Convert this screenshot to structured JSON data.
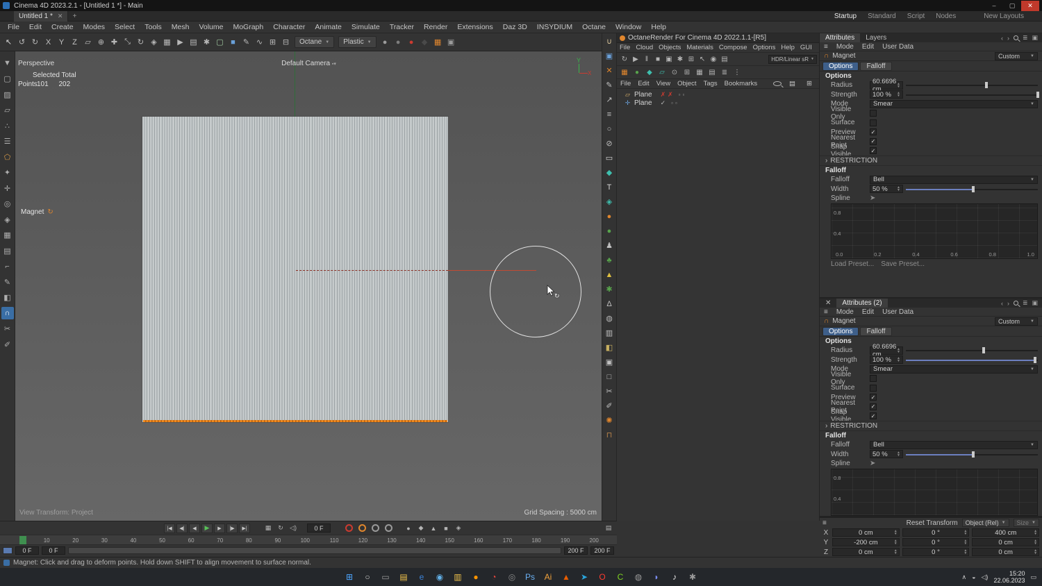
{
  "titlebar": {
    "title": "Cinema 4D 2023.2.1 - [Untitled 1 *] - Main"
  },
  "tabbar": {
    "tab_label": "Untitled 1 *",
    "layouts": [
      {
        "name": "layout-startup",
        "label": "Startup",
        "cls": "active"
      },
      {
        "name": "layout-standard",
        "label": "Standard"
      },
      {
        "name": "layout-script",
        "label": "Script"
      },
      {
        "name": "layout-nodes",
        "label": "Nodes"
      }
    ],
    "new_layout_label": "New Layouts"
  },
  "menubar": [
    "File",
    "Edit",
    "Create",
    "Modes",
    "Select",
    "Tools",
    "Mesh",
    "Volume",
    "MoGraph",
    "Character",
    "Animate",
    "Simulate",
    "Tracker",
    "Render",
    "Extensions",
    "Daz 3D",
    "INSYDIUM",
    "Octane",
    "Window",
    "Help"
  ],
  "toolbar": {
    "icons_a": [
      {
        "name": "live-selection-icon",
        "glyph": "↖",
        "color": "#d8d8d8"
      },
      {
        "name": "undo-icon",
        "glyph": "↺",
        "color": "#b8b8b8"
      },
      {
        "name": "redo-icon",
        "glyph": "↻",
        "color": "#b8b8b8"
      },
      {
        "name": "lock-x-axis-icon",
        "glyph": "X",
        "color": "#c4c4c4"
      },
      {
        "name": "lock-y-axis-icon",
        "glyph": "Y",
        "color": "#c4c4c4"
      },
      {
        "name": "lock-z-axis-icon",
        "glyph": "Z",
        "color": "#c4c4c4"
      },
      {
        "name": "workplane-icon",
        "glyph": "▱",
        "color": "#b8b8b8"
      },
      {
        "name": "coordinate-system-icon",
        "glyph": "⊕",
        "color": "#b8b8b8"
      },
      {
        "name": "move-tool-icon",
        "glyph": "✚",
        "color": "#b8b8b8"
      },
      {
        "name": "scale-tool-icon",
        "glyph": "⤡",
        "color": "#b8b8b8"
      },
      {
        "name": "rotate-tool-icon",
        "glyph": "↻",
        "color": "#b8b8b8"
      },
      {
        "name": "snap-icon",
        "glyph": "◈",
        "color": "#b8b8b8"
      },
      {
        "name": "quantize-icon",
        "glyph": "▦",
        "color": "#b8b8b8"
      },
      {
        "name": "render-view-icon",
        "glyph": "▶",
        "color": "#b8b8b8"
      },
      {
        "name": "render-picture-viewer-icon",
        "glyph": "▤",
        "color": "#b8b8b8"
      },
      {
        "name": "render-settings-icon",
        "glyph": "✱",
        "color": "#b8b8b8"
      },
      {
        "name": "model-mode-icon",
        "glyph": "▢",
        "color": "#9fc79f"
      },
      {
        "name": "cube-primitive-icon",
        "glyph": "■",
        "color": "#6aa0d8"
      },
      {
        "name": "pen-tool-icon",
        "glyph": "✎",
        "color": "#b8b8b8"
      },
      {
        "name": "spline-tool-icon",
        "glyph": "∿",
        "color": "#b8b8b8"
      },
      {
        "name": "array-icon",
        "glyph": "⊞",
        "color": "#b8b8b8"
      },
      {
        "name": "instance-icon",
        "glyph": "⊟",
        "color": "#b8b8b8"
      }
    ],
    "octane_btn": "Octane",
    "plastic_btn": "Plastic",
    "icons_b": [
      {
        "name": "material-sphere-icon",
        "glyph": "●",
        "color": "#9c9c9c"
      },
      {
        "name": "material-sphere-2-icon",
        "glyph": "●",
        "color": "#7d7d7d"
      },
      {
        "name": "xparticles-icon",
        "glyph": "●",
        "color": "#cc3b30"
      },
      {
        "name": "insydium-icon",
        "glyph": "◆",
        "color": "#4a4a4a"
      },
      {
        "name": "turbulencefd-icon",
        "glyph": "▦",
        "color": "#e0862d"
      },
      {
        "name": "cubes-array-icon",
        "glyph": "▣",
        "color": "#9a9a9a"
      }
    ]
  },
  "left_palette": [
    {
      "name": "convert-icon",
      "glyph": "▼",
      "color": "#aeaeae"
    },
    {
      "name": "model-mode-icon",
      "glyph": "▢",
      "color": "#aeaeae"
    },
    {
      "name": "texture-mode-icon",
      "glyph": "▨",
      "color": "#aeaeae"
    },
    {
      "name": "workplane-mode-icon",
      "glyph": "▱",
      "color": "#aeaeae"
    },
    {
      "name": "points-mode-icon",
      "glyph": "∴",
      "color": "#aeaeae"
    },
    {
      "name": "edges-mode-icon",
      "glyph": "☰",
      "color": "#aeaeae"
    },
    {
      "name": "polygons-mode-icon",
      "glyph": "⬠",
      "color": "#d89b4a"
    },
    {
      "name": "tweak-mode-icon",
      "glyph": "✦",
      "color": "#aeaeae"
    },
    {
      "name": "enable-axis-icon",
      "glyph": "✛",
      "color": "#aeaeae"
    },
    {
      "name": "viewport-solo-icon",
      "glyph": "◎",
      "color": "#aeaeae"
    },
    {
      "name": "snap-toggle-icon",
      "glyph": "◈",
      "color": "#aeaeae"
    },
    {
      "name": "quantize-toggle-icon",
      "glyph": "▦",
      "color": "#aeaeae"
    },
    {
      "name": "workplane-snap-icon",
      "glyph": "▤",
      "color": "#aeaeae"
    },
    {
      "name": "measure-icon",
      "glyph": "⌐",
      "color": "#aeaeae"
    },
    {
      "name": "brush-icon",
      "glyph": "✎",
      "color": "#aeaeae"
    },
    {
      "name": "mirror-icon",
      "glyph": "◧",
      "color": "#aeaeae"
    },
    {
      "name": "magnet-tool-icon",
      "glyph": "∩",
      "color": "#ffffff",
      "cls": "active"
    },
    {
      "name": "knife-icon",
      "glyph": "✂",
      "color": "#aeaeae"
    },
    {
      "name": "paint-icon",
      "glyph": "✐",
      "color": "#aeaeae"
    }
  ],
  "viewport": {
    "view_label": "Perspective",
    "hud_line1": "Selected Total",
    "hud_points_label": "Points",
    "hud_points_selected": "101",
    "hud_points_total": "202",
    "camera_label": "Default Camera",
    "tool_hint": "Magnet",
    "axis_y": "Y",
    "axis_x": "X",
    "transform_label": "View Transform: Project",
    "grid_label": "Grid Spacing : 5000 cm"
  },
  "right_strip": [
    {
      "name": "coffee-cup-icon",
      "glyph": "∪",
      "color": "#d8c49a"
    },
    {
      "name": "uv-edit-icon",
      "glyph": "▣",
      "color": "#6a9fd8"
    },
    {
      "name": "xpresso-icon",
      "glyph": "✕",
      "color": "#e0862d"
    },
    {
      "name": "pen-icon",
      "glyph": "✎",
      "color": "#c0c0c0"
    },
    {
      "name": "export-icon",
      "glyph": "↗",
      "color": "#c0c0c0"
    },
    {
      "name": "list-icon",
      "glyph": "≡",
      "color": "#c0c0c0"
    },
    {
      "name": "circle-icon",
      "glyph": "○",
      "color": "#c0c0c0"
    },
    {
      "name": "prohibit-icon",
      "glyph": "⊘",
      "color": "#c0c0c0"
    },
    {
      "name": "plane-primitive-icon",
      "glyph": "▭",
      "color": "#d8d8d8"
    },
    {
      "name": "diamond-icon",
      "glyph": "◆",
      "color": "#3fbfae"
    },
    {
      "name": "text-tool-icon",
      "glyph": "T",
      "color": "#d8d8d8"
    },
    {
      "name": "diamond-small-icon",
      "glyph": "◈",
      "color": "#3fbfae"
    },
    {
      "name": "octane-sphere-icon",
      "glyph": "●",
      "color": "#e0862d"
    },
    {
      "name": "green-sphere-icon",
      "glyph": "●",
      "color": "#58a44c"
    },
    {
      "name": "figure-icon",
      "glyph": "♟",
      "color": "#c0c0c0"
    },
    {
      "name": "tree-icon",
      "glyph": "♣",
      "color": "#58a44c"
    },
    {
      "name": "warning-icon",
      "glyph": "▲",
      "color": "#e0c040"
    },
    {
      "name": "gear-green-icon",
      "glyph": "✱",
      "color": "#58a44c"
    },
    {
      "name": "flask-icon",
      "glyph": "Δ",
      "color": "#c0c0c0"
    },
    {
      "name": "sphere-gray-icon",
      "glyph": "◍",
      "color": "#b8b8b8"
    },
    {
      "name": "chart-icon",
      "glyph": "▥",
      "color": "#c0c0c0"
    },
    {
      "name": "palette-icon",
      "glyph": "◧",
      "color": "#c8b060"
    },
    {
      "name": "camera-icon",
      "glyph": "▣",
      "color": "#c0c0c0"
    },
    {
      "name": "screen-icon",
      "glyph": "□",
      "color": "#c0c0c0"
    },
    {
      "name": "scissors-icon",
      "glyph": "✂",
      "color": "#c0c0c0"
    },
    {
      "name": "pen2-icon",
      "glyph": "✐",
      "color": "#c0c0c0"
    },
    {
      "name": "flower-icon",
      "glyph": "✺",
      "color": "#e0862d"
    },
    {
      "name": "chair-icon",
      "glyph": "⊓",
      "color": "#b8834a"
    }
  ],
  "octane_win": {
    "title": "OctaneRender For Cinema 4D 2022.1.1-[R5]",
    "menus": [
      "File",
      "Cloud",
      "Objects",
      "Materials",
      "Compose",
      "Options",
      "Help",
      "GUI"
    ],
    "lut_label": "HDR/Linear sR",
    "tb1_icons": [
      {
        "name": "refresh-icon",
        "glyph": "↻",
        "color": "#b4b4b4"
      },
      {
        "name": "render-start-icon",
        "glyph": "▶",
        "color": "#b4b4b4"
      },
      {
        "name": "pause-icon",
        "glyph": "‖",
        "color": "#b4b4b4"
      },
      {
        "name": "stop-icon",
        "glyph": "■",
        "color": "#b4b4b4"
      },
      {
        "name": "lock-resolution-icon",
        "glyph": "▣",
        "color": "#b4b4b4"
      },
      {
        "name": "settings-gear-icon",
        "glyph": "✱",
        "color": "#b4b4b4"
      },
      {
        "name": "region-render-icon",
        "glyph": "⊞",
        "color": "#b4b4b4"
      },
      {
        "name": "pick-material-icon",
        "glyph": "↖",
        "color": "#b4b4b4"
      },
      {
        "name": "camera-view-icon",
        "glyph": "◉",
        "color": "#b4b4b4"
      },
      {
        "name": "film-settings-icon",
        "glyph": "▤",
        "color": "#b4b4b4"
      }
    ],
    "tb2_icons": [
      {
        "name": "octane-cube-icon",
        "glyph": "▦",
        "color": "#e0862d"
      },
      {
        "name": "livedb-icon",
        "glyph": "●",
        "color": "#58a44c"
      },
      {
        "name": "node-icon",
        "glyph": "◆",
        "color": "#3fbfae"
      },
      {
        "name": "plane-light-icon",
        "glyph": "▱",
        "color": "#3fbfae"
      },
      {
        "name": "target-icon",
        "glyph": "⊙",
        "color": "#b4b4b4"
      },
      {
        "name": "grid-a-icon",
        "glyph": "⊞",
        "color": "#b4b4b4"
      },
      {
        "name": "grid-b-icon",
        "glyph": "▦",
        "color": "#b4b4b4"
      },
      {
        "name": "grid-c-icon",
        "glyph": "▤",
        "color": "#b4b4b4"
      },
      {
        "name": "rows-icon",
        "glyph": "≣",
        "color": "#b4b4b4"
      },
      {
        "name": "dots-icon",
        "glyph": "⋮",
        "color": "#b4b4b4"
      }
    ]
  },
  "object_manager": {
    "menus": [
      "File",
      "Edit",
      "View",
      "Object",
      "Tags",
      "Bookmarks"
    ],
    "objects": [
      {
        "name": "Plane",
        "mark1": "✗",
        "mark2": "✗"
      },
      {
        "name": "Plane",
        "mark1": "✓",
        "mark2": ""
      }
    ]
  },
  "attributes": [
    {
      "tab_attributes": "Attributes",
      "tab_layers": "Layers",
      "menu_mode": "Mode",
      "menu_edit": "Edit",
      "menu_user_data": "User Data",
      "object_name": "Magnet",
      "preset": "Custom",
      "tab_options": "Options",
      "tab_falloff": "Falloff",
      "section_options": "Options",
      "radius_label": "Radius",
      "radius_value": "60.6696 cm",
      "strength_label": "Strength",
      "strength_value": "100 %",
      "mode_label": "Mode",
      "mode_value": "Smear",
      "visible_only_label": "Visible Only",
      "surface_label": "Surface",
      "preview_label": "Preview",
      "nearest_label": "Nearest Point",
      "snap_label": "Snap Visible",
      "section_restriction": "RESTRICTION",
      "section_falloff": "Falloff",
      "falloff_label": "Falloff",
      "falloff_value": "Bell",
      "width_label": "Width",
      "width_value": "50 %",
      "spline_label": "Spline",
      "graph_y1": "0.8",
      "graph_y2": "0.4",
      "graph_x": [
        "0.0",
        "0.2",
        "0.4",
        "0.6",
        "0.8",
        "1.0"
      ],
      "load_preset": "Load Preset...",
      "save_preset": "Save Preset..."
    },
    {
      "header": "Attributes (2)",
      "menu_mode": "Mode",
      "menu_edit": "Edit",
      "menu_user_data": "User Data",
      "object_name": "Magnet",
      "preset": "Custom",
      "tab_options": "Options",
      "tab_falloff": "Falloff",
      "section_options": "Options",
      "radius_label": "Radius",
      "radius_value": "60.6696 cm",
      "strength_label": "Strength",
      "strength_value": "100 %",
      "mode_label": "Mode",
      "mode_value": "Smear",
      "visible_only_label": "Visible Only",
      "surface_label": "Surface",
      "preview_label": "Preview",
      "nearest_label": "Nearest Point",
      "snap_label": "Snap Visible",
      "section_restriction": "RESTRICTION",
      "section_falloff": "Falloff",
      "falloff_label": "Falloff",
      "falloff_value": "Bell",
      "width_label": "Width",
      "width_value": "50 %",
      "spline_label": "Spline",
      "graph_y1": "0.8",
      "graph_y2": "0.4"
    }
  ],
  "coordinates": {
    "reset_btn": "Reset Transform",
    "mode_dropdown": "Object (Rel)",
    "size_dropdown": "Size",
    "rows": [
      {
        "axis": "X",
        "pos": "0 cm",
        "rot": "0 °",
        "size": "400 cm"
      },
      {
        "axis": "Y",
        "pos": "-200 cm",
        "rot": "0 °",
        "size": "0 cm"
      },
      {
        "axis": "Z",
        "pos": "0 cm",
        "rot": "0 °",
        "size": "0 cm"
      }
    ]
  },
  "timeline": {
    "frame_value": "0 F",
    "ticks": [
      "10",
      "20",
      "30",
      "40",
      "50",
      "60",
      "70",
      "80",
      "90",
      "100",
      "110",
      "120",
      "130",
      "140",
      "150",
      "160",
      "170",
      "180",
      "190",
      "200"
    ],
    "range_start_a": "0 F",
    "range_start_b": "0 F",
    "range_end_a": "200 F",
    "range_end_b": "200 F"
  },
  "statusbar": {
    "message": "Magnet: Click and drag to deform points. Hold down SHIFT to align movement to surface normal."
  },
  "taskbar": {
    "icons": [
      {
        "name": "start-button-icon",
        "glyph": "⊞",
        "color": "#4da6ff"
      },
      {
        "name": "search-icon",
        "glyph": "○",
        "color": "#cfcfcf"
      },
      {
        "name": "task-view-icon",
        "glyph": "▭",
        "color": "#9a9a9a"
      },
      {
        "name": "file-explorer-icon",
        "glyph": "▤",
        "color": "#f0c24b"
      },
      {
        "name": "edge-icon",
        "glyph": "e",
        "color": "#3b82d8"
      },
      {
        "name": "browser-icon",
        "glyph": "◉",
        "color": "#62b0e8"
      },
      {
        "name": "folder-icon",
        "glyph": "▥",
        "color": "#f0c24b"
      },
      {
        "name": "firefox-icon",
        "glyph": "●",
        "color": "#ff9500"
      },
      {
        "name": "chrome-icon",
        "glyph": "◔",
        "color": "#e8453c"
      },
      {
        "name": "obs-icon",
        "glyph": "◎",
        "color": "#8a8a8a"
      },
      {
        "name": "photoshop-icon",
        "glyph": "Ps",
        "color": "#6ab0f3"
      },
      {
        "name": "illustrator-icon",
        "glyph": "Ai",
        "color": "#f2a33c"
      },
      {
        "name": "vlc-icon",
        "glyph": "▲",
        "color": "#e85d00"
      },
      {
        "name": "telegram-icon",
        "glyph": "➤",
        "color": "#2aa5dd"
      },
      {
        "name": "opera-icon",
        "glyph": "O",
        "color": "#ff3b30"
      },
      {
        "name": "cinema4d-icon",
        "glyph": "C",
        "color": "#7ed321"
      },
      {
        "name": "steam-icon",
        "glyph": "◍",
        "color": "#9a9a9a"
      },
      {
        "name": "discord-icon",
        "glyph": "◗",
        "color": "#7a8cf2"
      },
      {
        "name": "music-icon",
        "glyph": "♪",
        "color": "#e8e8e8"
      },
      {
        "name": "settings-icon",
        "glyph": "✱",
        "color": "#9a9a9a"
      }
    ],
    "time": "15:20",
    "date": "22.06.2023"
  }
}
